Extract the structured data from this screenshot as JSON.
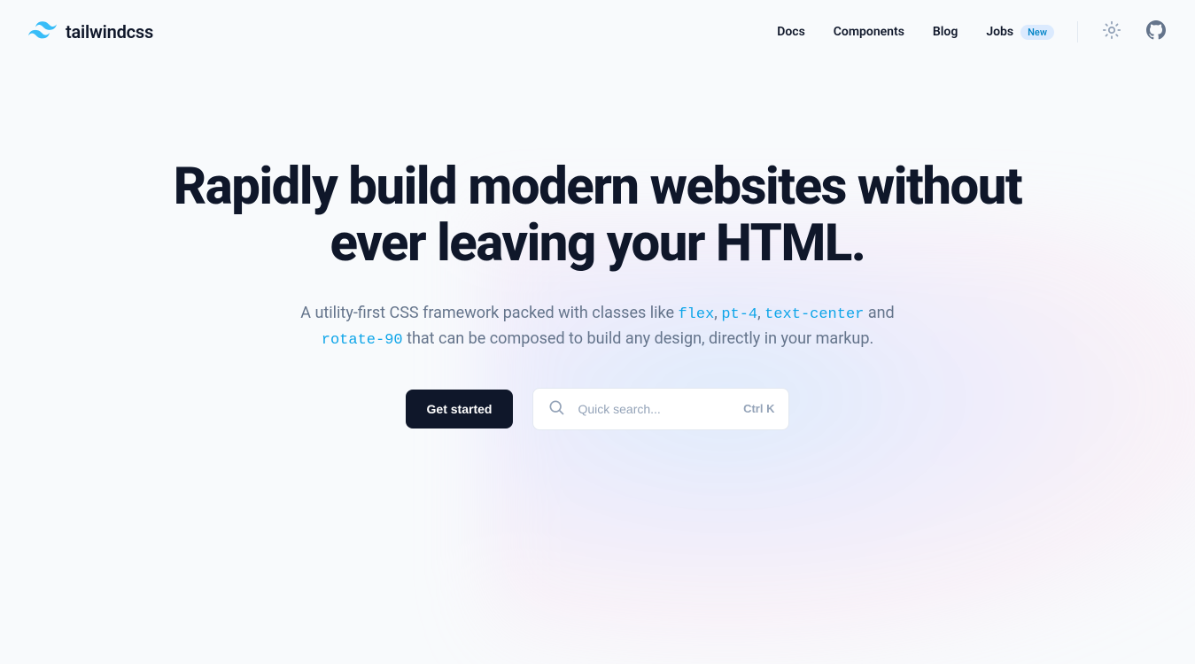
{
  "brand": {
    "name": "tailwindcss"
  },
  "nav": {
    "docs": "Docs",
    "components": "Components",
    "blog": "Blog",
    "jobs": "Jobs",
    "jobs_badge": "New"
  },
  "hero": {
    "title": "Rapidly build modern websites without ever leaving your HTML.",
    "sub_pre": "A utility-first CSS framework packed with classes like ",
    "code1": "flex",
    "sep1": ", ",
    "code2": "pt-4",
    "sep2": ", ",
    "code3": "text-center",
    "sep3": " and ",
    "code4": "rotate-90",
    "sub_post": " that can be composed to build any design, directly in your markup."
  },
  "cta": {
    "button": "Get started",
    "search_placeholder": "Quick search...",
    "kbd_mod": "Ctrl ",
    "kbd_key": "K"
  }
}
